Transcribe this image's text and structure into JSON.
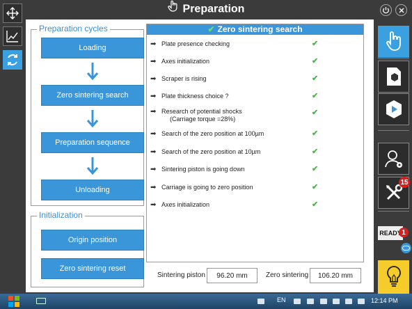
{
  "window": {
    "title": "Preparation"
  },
  "left_toolbar": [
    {
      "icon": "move-arrows-icon"
    },
    {
      "icon": "chart-icon"
    },
    {
      "icon": "cycle-icon",
      "active": true
    }
  ],
  "preparation_cycles": {
    "title": "Preparation cycles",
    "steps": [
      "Loading",
      "Zero sintering search",
      "Preparation sequence",
      "Unloading"
    ]
  },
  "initialization": {
    "title": "Initialization",
    "buttons": [
      "Origin position",
      "Zero sintering reset"
    ]
  },
  "status_panel": {
    "title": "Zero sintering search",
    "items": [
      {
        "text": "Plate presence checking",
        "done": true
      },
      {
        "text": "Axes initialization",
        "done": true
      },
      {
        "text": "Scraper is rising",
        "done": true
      },
      {
        "text": "Plate thickness choice ?",
        "done": true
      },
      {
        "text": "Research of potential shocks",
        "subtext": "(Carriage torque =28%)",
        "done": true
      },
      {
        "text": "Search of the zero position at 100µm",
        "done": true
      },
      {
        "text": "Search of the zero position at 10µm",
        "done": true
      },
      {
        "text": "Sintering piston is going down",
        "done": true
      },
      {
        "text": "Carriage is going to zero position",
        "done": true
      },
      {
        "text": "Axes initialization",
        "done": true
      }
    ]
  },
  "readouts": {
    "sintering_piston_label": "Sintering piston",
    "sintering_piston_value": "96.20 mm",
    "zero_sintering_label": "Zero sintering",
    "zero_sintering_value": "106.20 mm"
  },
  "right_toolbar": {
    "notifications_count": "15",
    "ready_label": "READY",
    "ready_count": "1"
  },
  "taskbar": {
    "language": "EN",
    "time": "12:14 PM"
  },
  "colors": {
    "accent_blue": "#3a96d8",
    "check_green": "#4cb54c",
    "badge_red": "#d62020",
    "bulb_yellow": "#f5cc2a"
  }
}
